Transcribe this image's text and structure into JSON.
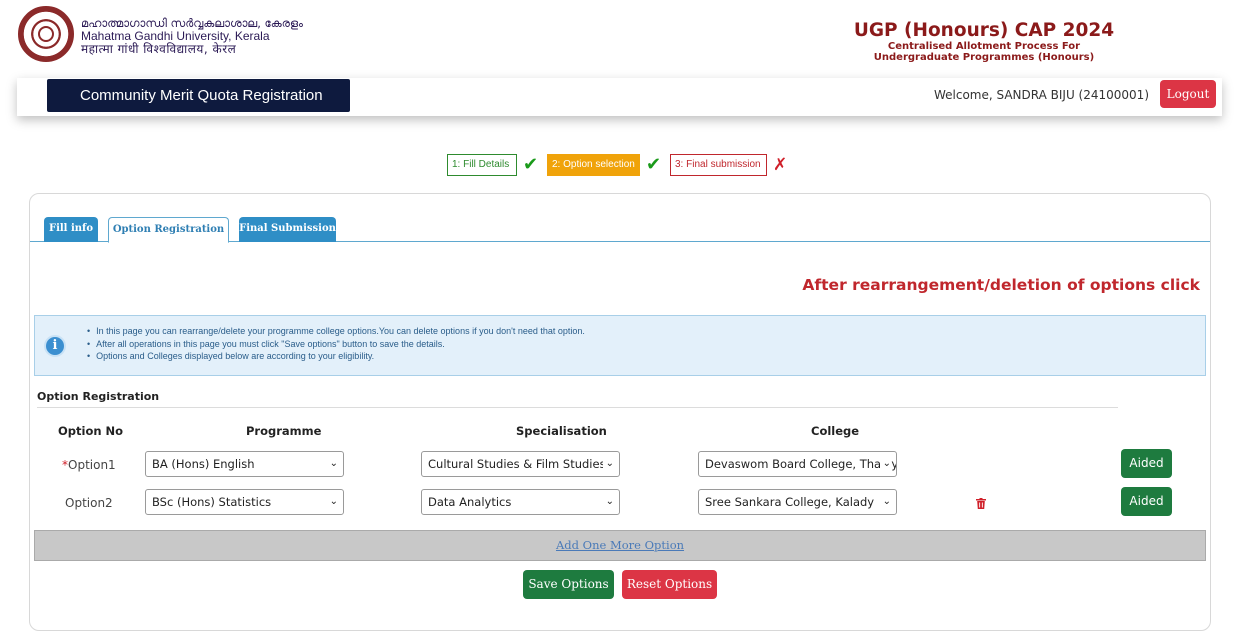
{
  "header": {
    "university_malayalam": "മഹാത്മാഗാന്ധി സർവ്വകലാശാല, കേരളം",
    "university_english": "Mahatma Gandhi University, Kerala",
    "university_hindi": "महात्मा गांधी विश्वविद्यालय, केरल",
    "cap_title": "UGP (Honours) CAP 2024",
    "cap_subtitle_1": "Centralised Allotment Process For",
    "cap_subtitle_2": "Undergraduate Programmes (Honours)"
  },
  "navbar": {
    "title": "Community Merit Quota Registration",
    "welcome": "Welcome, SANDRA BIJU (24100001)",
    "logout": "Logout"
  },
  "steps": [
    {
      "label": "1: Fill Details",
      "status": "done"
    },
    {
      "label": "2: Option selection",
      "status": "done"
    },
    {
      "label": "3: Final submission",
      "status": "pending"
    }
  ],
  "tabs": [
    "Fill info",
    "Option Registration",
    "Final Submission"
  ],
  "notice": "After rearrangement/deletion of options click",
  "info": [
    "In this page you can rearrange/delete your programme college options.You can delete options if you don't need that option.",
    "After all operations in this page you must click \"Save options\" button to save the details.",
    "Options and Colleges displayed below are according to your eligibility."
  ],
  "section_title": "Option Registration",
  "columns": {
    "option_no": "Option No",
    "programme": "Programme",
    "specialisation": "Specialisation",
    "college": "College"
  },
  "options": [
    {
      "prefix": "*",
      "label": "Option1",
      "programme": "BA (Hons) English",
      "specialisation": "Cultural Studies & Film Studies",
      "college": "Devaswom Board College, Thalayolaparambu",
      "type": "Aided"
    },
    {
      "prefix": "",
      "label": "Option2",
      "programme": "BSc (Hons) Statistics",
      "specialisation": "Data Analytics",
      "college": "Sree Sankara College, Kalady",
      "type": "Aided"
    }
  ],
  "add_option": "Add One More Option",
  "buttons": {
    "save": "Save Options",
    "reset": "Reset Options"
  },
  "colors": {
    "navy": "#0e1a3e",
    "danger": "#dc3545",
    "success": "#1e7b3f",
    "tab_blue": "#2f8ec6",
    "maroon": "#8b1a1a"
  }
}
